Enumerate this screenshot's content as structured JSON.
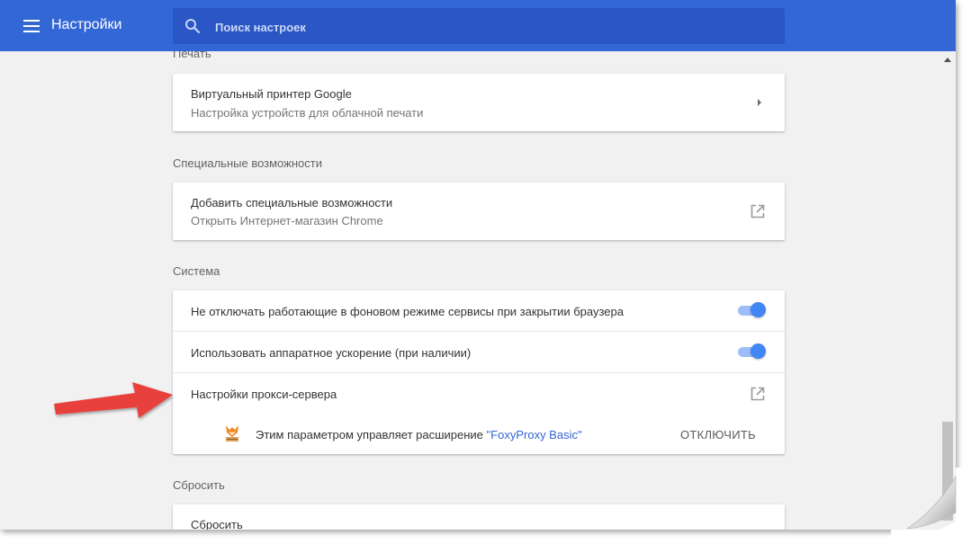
{
  "header": {
    "title": "Настройки",
    "search_placeholder": "Поиск настроек"
  },
  "sections": {
    "print": {
      "title": "Печать",
      "items": [
        {
          "title": "Виртуальный принтер Google",
          "subtitle": "Настройка устройств для облачной печати"
        }
      ]
    },
    "accessibility": {
      "title": "Специальные возможности",
      "items": [
        {
          "title": "Добавить специальные возможности",
          "subtitle": "Открыть Интернет-магазин Chrome"
        }
      ]
    },
    "system": {
      "title": "Система",
      "items": [
        {
          "title": "Не отключать работающие в фоновом режиме сервисы при закрытии браузера",
          "toggle": true
        },
        {
          "title": "Использовать аппаратное ускорение (при наличии)",
          "toggle": true
        },
        {
          "title": "Настройки прокси-сервера"
        }
      ],
      "extension_notice": {
        "text": "Этим параметром управляет расширение",
        "extension_name": "\"FoxyProxy Basic\"",
        "button": "ОТКЛЮЧИТЬ"
      }
    },
    "reset": {
      "title": "Сбросить",
      "items": [
        {
          "title": "Сбросить"
        }
      ]
    }
  },
  "colors": {
    "accent": "#3367d6",
    "toggle_on": "#4285f4",
    "annotation_arrow": "#e8413e"
  }
}
